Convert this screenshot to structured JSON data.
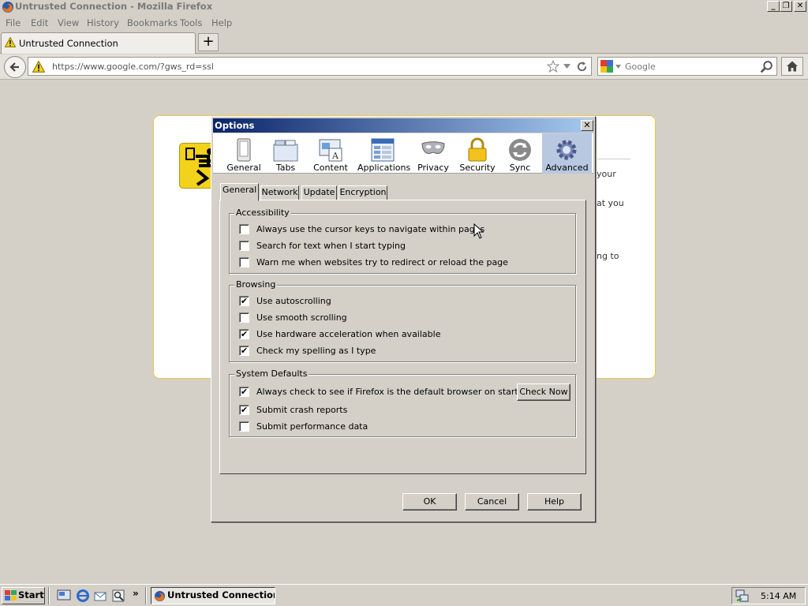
{
  "window": {
    "title": "Untrusted Connection - Mozilla Firefox",
    "controls": {
      "minimize": "_",
      "restore": "❐",
      "close": "✕"
    }
  },
  "menu": [
    "File",
    "Edit",
    "View",
    "History",
    "Bookmarks",
    "Tools",
    "Help"
  ],
  "tab": {
    "title": "Untrusted Connection",
    "new_tab_label": "+"
  },
  "navigation": {
    "url": "https://www.google.com/?gws_rd=ssl",
    "search_placeholder": "Google"
  },
  "background_page": {
    "fragments": [
      "your",
      "at you",
      "ng to"
    ]
  },
  "dialog": {
    "title": "Options",
    "close_label": "✕",
    "panes": [
      {
        "label": "General",
        "icon": "general-pane-icon"
      },
      {
        "label": "Tabs",
        "icon": "tabs-pane-icon"
      },
      {
        "label": "Content",
        "icon": "content-pane-icon"
      },
      {
        "label": "Applications",
        "icon": "applications-pane-icon"
      },
      {
        "label": "Privacy",
        "icon": "privacy-mask-icon"
      },
      {
        "label": "Security",
        "icon": "padlock-icon"
      },
      {
        "label": "Sync",
        "icon": "sync-icon"
      },
      {
        "label": "Advanced",
        "icon": "gear-icon"
      }
    ],
    "selected_pane": "Advanced",
    "sub_tabs": [
      "General",
      "Network",
      "Update",
      "Encryption"
    ],
    "selected_sub_tab": "General",
    "groups": {
      "accessibility": {
        "label": "Accessibility",
        "options": [
          {
            "label": "Always use the cursor keys to navigate within pages",
            "checked": false
          },
          {
            "label": "Search for text when I start typing",
            "checked": false
          },
          {
            "label": "Warn me when websites try to redirect or reload the page",
            "checked": false
          }
        ]
      },
      "browsing": {
        "label": "Browsing",
        "options": [
          {
            "label": "Use autoscrolling",
            "checked": true
          },
          {
            "label": "Use smooth scrolling",
            "checked": false
          },
          {
            "label": "Use hardware acceleration when available",
            "checked": true
          },
          {
            "label": "Check my spelling as I type",
            "checked": true
          }
        ]
      },
      "system_defaults": {
        "label": "System Defaults",
        "options": [
          {
            "label": "Always check to see if Firefox is the default browser on startup",
            "checked": true
          },
          {
            "label": "Submit crash reports",
            "checked": true
          },
          {
            "label": "Submit performance data",
            "checked": false
          }
        ],
        "check_now_label": "Check Now"
      }
    },
    "buttons": {
      "ok": "OK",
      "cancel": "Cancel",
      "help": "Help"
    },
    "check_mark": "✔"
  },
  "taskbar": {
    "start_label": "Start",
    "task_label": "Untrusted Connection ...",
    "overflow_label": "»",
    "clock": "5:14 AM"
  },
  "colors": {
    "dialog_titlebar_start": "#0a246a",
    "dialog_titlebar_end": "#a6caf0",
    "warning_yellow": "#f2d21a",
    "selected_pane": "#b8c8e0"
  }
}
